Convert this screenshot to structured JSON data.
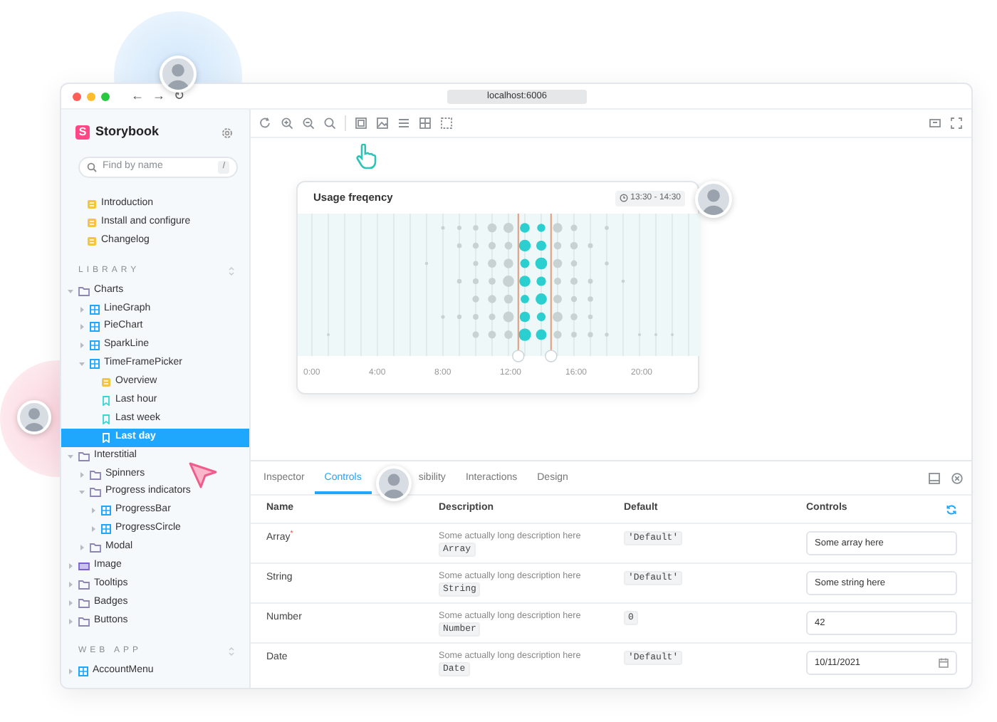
{
  "browser": {
    "url": "localhost:6006",
    "nav_buttons": [
      "←",
      "→",
      "↻"
    ]
  },
  "sidebar": {
    "brand_mark": "S",
    "brand": "Storybook",
    "search": {
      "placeholder": "Find by name",
      "shortcut": "/"
    },
    "docs": [
      {
        "kind": "doc",
        "label": "Introduction",
        "selected": false
      },
      {
        "kind": "doc",
        "label": "Install and configure",
        "selected": false
      },
      {
        "kind": "doc",
        "label": "Changelog",
        "selected": false
      }
    ],
    "sections": [
      {
        "title": "LIBRARY",
        "items": [
          {
            "kind": "folder",
            "label": "Charts",
            "selected": false,
            "expanded": true,
            "children": [
              {
                "kind": "component",
                "label": "LineGraph",
                "selected": false,
                "expanded": false
              },
              {
                "kind": "component",
                "label": "PieChart",
                "selected": false,
                "expanded": false
              },
              {
                "kind": "component",
                "label": "SparkLine",
                "selected": false,
                "expanded": false
              },
              {
                "kind": "component",
                "label": "TimeFramePicker",
                "selected": false,
                "expanded": true,
                "children": [
                  {
                    "kind": "doc",
                    "label": "Overview",
                    "selected": false
                  },
                  {
                    "kind": "story",
                    "label": "Last hour",
                    "selected": false
                  },
                  {
                    "kind": "story",
                    "label": "Last week",
                    "selected": false
                  },
                  {
                    "kind": "story",
                    "label": "Last day",
                    "selected": true
                  }
                ]
              }
            ]
          },
          {
            "kind": "folder",
            "label": "Interstitial",
            "selected": false,
            "expanded": true,
            "children": [
              {
                "kind": "folder",
                "label": "Spinners",
                "selected": false,
                "expanded": false
              },
              {
                "kind": "folder",
                "label": "Progress indicators",
                "selected": false,
                "expanded": true,
                "children": [
                  {
                    "kind": "component",
                    "label": "ProgressBar",
                    "selected": false,
                    "expanded": false
                  },
                  {
                    "kind": "component",
                    "label": "ProgressCircle",
                    "selected": false,
                    "expanded": false
                  }
                ]
              },
              {
                "kind": "folder",
                "label": "Modal",
                "selected": false,
                "expanded": false
              }
            ]
          },
          {
            "kind": "group",
            "label": "Image",
            "selected": false,
            "expanded": false
          },
          {
            "kind": "folder",
            "label": "Tooltips",
            "selected": false,
            "expanded": false
          },
          {
            "kind": "folder",
            "label": "Badges",
            "selected": false,
            "expanded": false
          },
          {
            "kind": "folder",
            "label": "Buttons",
            "selected": false,
            "expanded": false
          }
        ]
      },
      {
        "title": "WEB APP",
        "items": [
          {
            "kind": "component",
            "label": "AccountMenu",
            "selected": false,
            "expanded": false
          }
        ]
      }
    ]
  },
  "preview": {
    "card": {
      "title": "Usage freqency",
      "range": "13:30 - 14:30",
      "time_labels": [
        "0:00",
        "4:00",
        "8:00",
        "12:00",
        "16:00",
        "20:00"
      ]
    }
  },
  "addons": {
    "tabs": [
      {
        "label": "Inspector",
        "selected": false
      },
      {
        "label": "Controls",
        "selected": true
      },
      {
        "label": "sibility",
        "selected": false
      },
      {
        "label": "Interactions",
        "selected": false
      },
      {
        "label": "Design",
        "selected": false
      }
    ],
    "table": {
      "columns": [
        "Name",
        "Description",
        "Default",
        "Controls"
      ],
      "rows": [
        {
          "name": "Array$^{*}$",
          "description": "Some actually long description here",
          "type": "Array",
          "default": "'Default'",
          "control": {
            "kind": "text",
            "value": "Some array here"
          }
        },
        {
          "name": "String",
          "description": "Some actually long description here",
          "type": "String",
          "default": "'Default'",
          "control": {
            "kind": "text",
            "value": "Some string here"
          }
        },
        {
          "name": "Number",
          "description": "Some actually long description here",
          "type": "Number",
          "default": "0",
          "control": {
            "kind": "text",
            "value": "42"
          }
        },
        {
          "name": "Date",
          "description": "Some actually long description here",
          "type": "Date",
          "default": "'Default'",
          "control": {
            "kind": "date",
            "value": "10/11/2021"
          }
        }
      ]
    }
  }
}
